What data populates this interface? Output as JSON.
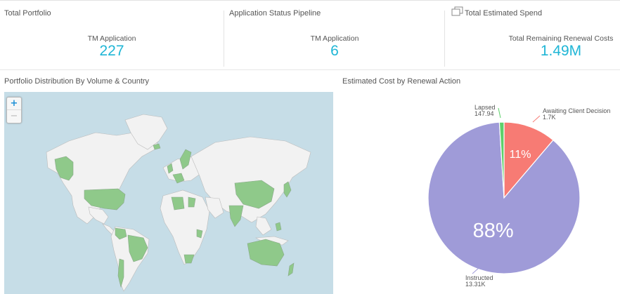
{
  "kpis": [
    {
      "title": "Total Portfolio",
      "label": "TM Application",
      "value": "227"
    },
    {
      "title": "Application Status Pipeline",
      "label": "TM Application",
      "value": "6"
    },
    {
      "title": "Total Estimated Spend",
      "label": "Total Remaining Renewal Costs",
      "value": "1.49M"
    }
  ],
  "map_panel": {
    "title": "Portfolio Distribution By Volume & Country",
    "zoom_in": "+",
    "zoom_out": "−"
  },
  "pie_panel": {
    "title": "Estimated Cost by Renewal Action"
  },
  "chart_data": {
    "type": "pie",
    "slices": [
      {
        "name": "Awaiting Client Decision",
        "value_label": "1.7K",
        "value": 1700,
        "percent_label": "11%",
        "color": "#f77b74"
      },
      {
        "name": "Instructed",
        "value_label": "13.31K",
        "value": 13310,
        "percent_label": "88%",
        "color": "#9f9bd8"
      },
      {
        "name": "Lapsed",
        "value_label": "147.94",
        "value": 147.94,
        "percent_label": "",
        "color": "#5ed06a"
      }
    ]
  },
  "colors": {
    "accent": "#1fb6d6",
    "map_ocean": "#c6dde7",
    "map_highlight": "#8fc98a",
    "map_land": "#f2f2f2"
  }
}
